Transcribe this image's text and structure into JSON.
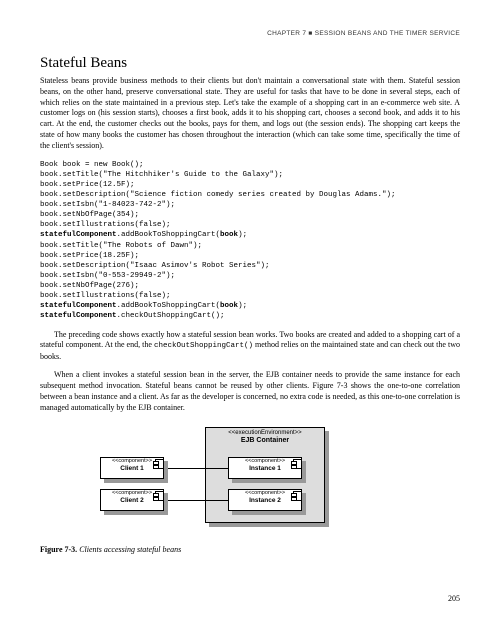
{
  "header": "CHAPTER 7 ■ SESSION BEANS AND THE TIMER SERVICE",
  "heading": "Stateful Beans",
  "p1": "Stateless beans provide business methods to their clients but don't maintain a conversational state with them. Stateful session beans, on the other hand, preserve conversational state. They are useful for tasks that have to be done in several steps, each of which relies on the state maintained in a previous step. Let's take the example of a shopping cart in an e-commerce web site. A customer logs on (his session starts), chooses a first book, adds it to his shopping cart, chooses a second book, and adds it to his cart. At the end, the customer checks out the books, pays for them, and logs out (the session ends). The shopping cart keeps the state of how many books the customer has chosen throughout the interaction (which can take some time, specifically the time of the client's session).",
  "code": {
    "l1": "Book book = new Book();",
    "l2": "book.setTitle(\"The Hitchhiker's Guide to the Galaxy\");",
    "l3": "book.setPrice(12.5F);",
    "l4": "book.setDescription(\"Science fiction comedy series created by Douglas Adams.\");",
    "l5": "book.setIsbn(\"1-84023-742-2\");",
    "l6": "book.setNbOfPage(354);",
    "l7": "book.setIllustrations(false);",
    "l8a": "statefulComponent",
    "l8b": ".addBookToShoppingCart(",
    "l8c": "book",
    "l8d": ");",
    "l9": "book.setTitle(\"The Robots of Dawn\");",
    "l10": "book.setPrice(18.25F);",
    "l11": "book.setDescription(\"Isaac Asimov's Robot Series\");",
    "l12": "book.setIsbn(\"0-553-29949-2\");",
    "l13": "book.setNbOfPage(276);",
    "l14": "book.setIllustrations(false);",
    "l15a": "statefulComponent",
    "l15b": ".addBookToShoppingCart(",
    "l15c": "book",
    "l15d": ");",
    "l16a": "statefulComponent",
    "l16b": ".checkOutShoppingCart();"
  },
  "p2a": "The preceding code shows exactly how a stateful session bean works. Two books are created and added to a shopping cart of a stateful component. At the end, the ",
  "p2b": "checkOutShoppingCart()",
  "p2c": " method relies on the maintained state and can check out the two books.",
  "p3": "When a client invokes a stateful session bean in the server, the EJB container needs to provide the same instance for each subsequent method invocation. Stateful beans cannot be reused by other clients. Figure 7-3 shows the one-to-one correlation between a bean instance and a client. As far as the developer is concerned, no extra code is needed, as this one-to-one correlation is managed automatically by the EJB container.",
  "uml": {
    "execEnv": "<<executionEnvironment>>",
    "ejb": "EJB Container",
    "compStereo": "<<component>>",
    "client1": "Client 1",
    "client2": "Client 2",
    "instance1": "Instance 1",
    "instance2": "Instance 2"
  },
  "fig": {
    "label": "Figure 7-3.",
    "text": " Clients accessing stateful beans"
  },
  "pageNum": "205"
}
